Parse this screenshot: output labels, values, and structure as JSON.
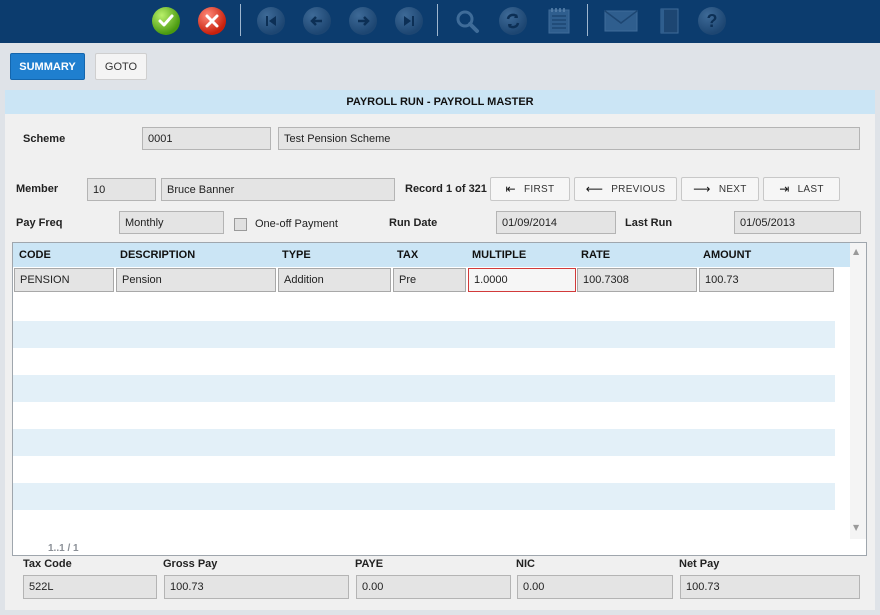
{
  "colors": {
    "toolbar_bg": "#0c3c6e",
    "accent": "#1f7fcf",
    "header_bg": "#cbe5f5",
    "active_cell_border": "#d23a3a"
  },
  "toolbar": {
    "icons": [
      "check-icon",
      "close-icon",
      "first-record-icon",
      "previous-record-icon",
      "next-record-icon",
      "last-record-icon",
      "search-icon",
      "refresh-icon",
      "notepad-icon",
      "email-icon",
      "book-icon",
      "help-icon"
    ],
    "help_glyph": "?"
  },
  "buttons": {
    "summary": "SUMMARY",
    "goto": "GOTO"
  },
  "panel": {
    "title": "PAYROLL RUN - PAYROLL MASTER"
  },
  "form": {
    "scheme_label": "Scheme",
    "scheme_code": "0001",
    "scheme_name": "Test Pension Scheme",
    "member_label": "Member",
    "member_id": "10",
    "member_name": "Bruce Banner",
    "record_info": "Record 1 of 321",
    "pay_freq_label": "Pay Freq",
    "pay_freq": "Monthly",
    "one_off_label": "One-off Payment",
    "run_date_label": "Run Date",
    "run_date": "01/09/2014",
    "last_run_label": "Last Run",
    "last_run": "01/05/2013"
  },
  "nav": {
    "first": "FIRST",
    "previous": "PREVIOUS",
    "next": "NEXT",
    "last": "LAST"
  },
  "grid": {
    "columns": [
      "CODE",
      "DESCRIPTION",
      "TYPE",
      "TAX",
      "MULTIPLE",
      "RATE",
      "AMOUNT"
    ],
    "rows": [
      {
        "code": "PENSION",
        "description": "Pension",
        "type": "Addition",
        "tax": "Pre",
        "multiple": "1.0000",
        "rate": "100.7308",
        "amount": "100.73"
      }
    ],
    "pager": "1..1 / 1"
  },
  "footer": {
    "tax_code_label": "Tax Code",
    "tax_code": "522L",
    "gross_pay_label": "Gross Pay",
    "gross_pay": "100.73",
    "paye_label": "PAYE",
    "paye": "0.00",
    "nic_label": "NIC",
    "nic": "0.00",
    "net_pay_label": "Net Pay",
    "net_pay": "100.73"
  }
}
